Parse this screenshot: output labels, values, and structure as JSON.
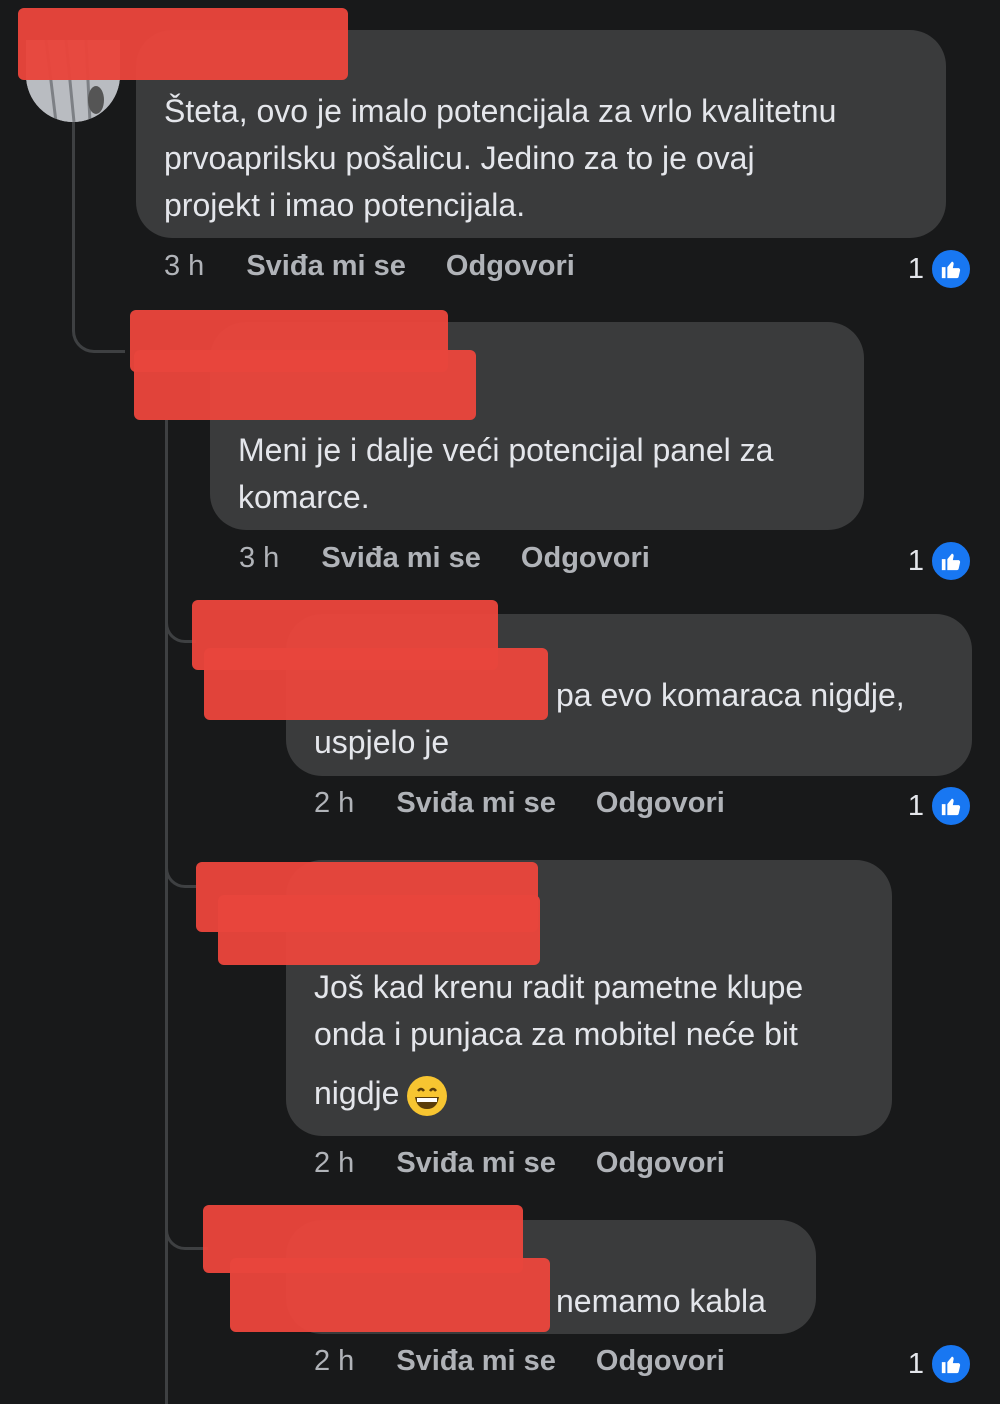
{
  "comments": [
    {
      "text_lines": [
        "Šteta, ovo je imalo potencijala za vrlo kvalitetnu",
        "prvoaprilsku pošalicu. Jedino za to je ovaj",
        "projekt i imao potencijala."
      ],
      "time": "3 h",
      "like_label": "Sviđa mi se",
      "reply_label": "Odgovori",
      "likes": "1"
    },
    {
      "text_lines": [
        "Meni je i dalje veći potencijal panel za",
        "komarce."
      ],
      "time": "3 h",
      "like_label": "Sviđa mi se",
      "reply_label": "Odgovori",
      "likes": "1"
    },
    {
      "text_lines": [
        "pa evo komaraca nigdje,",
        "uspjelo je"
      ],
      "time": "2 h",
      "like_label": "Sviđa mi se",
      "reply_label": "Odgovori",
      "likes": "1"
    },
    {
      "text_lines": [
        "Još kad krenu radit pametne klupe",
        "onda i punjaca za mobitel neće bit",
        "nigdje"
      ],
      "time": "2 h",
      "like_label": "Sviđa mi se",
      "reply_label": "Odgovori"
    },
    {
      "text_lines": [
        "nemamo kabla"
      ],
      "time": "2 h",
      "like_label": "Sviđa mi se",
      "reply_label": "Odgovori",
      "likes": "1"
    }
  ],
  "icons": {
    "like": "thumbs-up-icon",
    "emoji": "grinning-face-icon"
  },
  "colors": {
    "background": "#18191a",
    "bubble": "#3a3b3c",
    "like_blue": "#1877f2",
    "redaction": "#e8453c"
  }
}
